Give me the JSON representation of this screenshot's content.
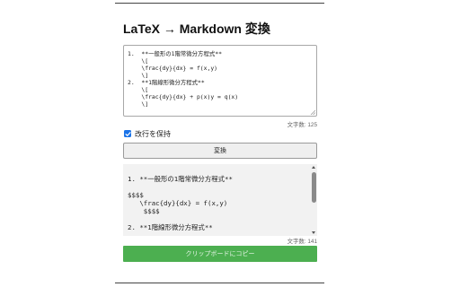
{
  "app": {
    "title": "LaTeX → Markdown 変換"
  },
  "input": {
    "value": "1.  **一般形の1階常微分方程式**\n    \\[\n    \\frac{dy}{dx} = f(x,y)\n    \\]\n2.  **1階線形微分方程式**\n    \\[\n    \\frac{dy}{dx} + p(x)y = q(x)\n    \\]",
    "char_count": "文字数: 125"
  },
  "options": {
    "keep_newlines_label": "改行を保持",
    "keep_newlines_checked": true
  },
  "actions": {
    "convert_label": "変換",
    "copy_label": "クリップボードにコピー"
  },
  "output": {
    "value": "1. **一般形の1階常微分方程式**\n\n$$$$\n   \\frac{dy}{dx} = f(x,y)\n    $$$$\n\n2. **1階線形微分方程式**",
    "char_count": "文字数: 141"
  },
  "colors": {
    "accent": "#1a73e8",
    "copy_button": "#4caf50"
  }
}
